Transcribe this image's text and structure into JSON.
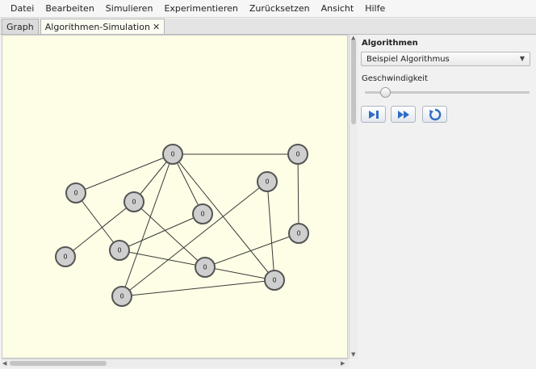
{
  "menubar": {
    "items": [
      "Datei",
      "Bearbeiten",
      "Simulieren",
      "Experimentieren",
      "Zurücksetzen",
      "Ansicht",
      "Hilfe"
    ]
  },
  "tabs": [
    {
      "label": "Graph"
    },
    {
      "label": "Algorithmen-Simulation",
      "close": "✕"
    }
  ],
  "graph": {
    "nodes": [
      "0",
      "0",
      "0",
      "0",
      "0",
      "0",
      "0",
      "0",
      "0",
      "0",
      "0",
      "0"
    ]
  },
  "side_panel": {
    "title": "Algorithmen",
    "algorithm_select": {
      "value": "Beispiel Algorithmus"
    },
    "speed_label": "Geschwindigkeit",
    "speed_value": 0.1
  },
  "controls": {
    "icons": [
      "step-icon",
      "fast-forward-icon",
      "reset-icon"
    ]
  },
  "colors": {
    "canvas_bg": "#fefee6",
    "node_fill": "#cfcfcf",
    "control_icon": "#2f6cc4"
  }
}
